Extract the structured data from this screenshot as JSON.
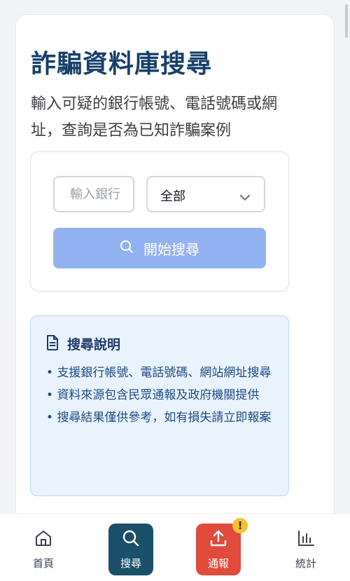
{
  "page": {
    "title": "詐騙資料庫搜尋",
    "subtitle": "輸入可疑的銀行帳號、電話號碼或網址，查詢是否為已知詐騙案例"
  },
  "search": {
    "input_placeholder": "輸入銀行",
    "category_selected": "全部",
    "submit_label": "開始搜尋"
  },
  "info": {
    "title": "搜尋說明",
    "items": [
      "支援銀行帳號、電話號碼、網站網址搜尋",
      "資料來源包含民眾通報及政府機關提供",
      "搜尋結果僅供參考，如有損失請立即報案"
    ]
  },
  "nav": {
    "items": [
      {
        "label": "首頁",
        "icon": "home-icon"
      },
      {
        "label": "搜尋",
        "icon": "search-icon",
        "active": true
      },
      {
        "label": "通報",
        "icon": "upload-icon",
        "badge": "!"
      },
      {
        "label": "統計",
        "icon": "bar-chart-icon"
      }
    ]
  },
  "colors": {
    "title": "#17406b",
    "button_disabled": "#93b2f2",
    "nav_active": "#1a5069",
    "nav_report": "#e04b3c",
    "badge": "#f6c234",
    "info_bg": "#e9f3fd"
  }
}
